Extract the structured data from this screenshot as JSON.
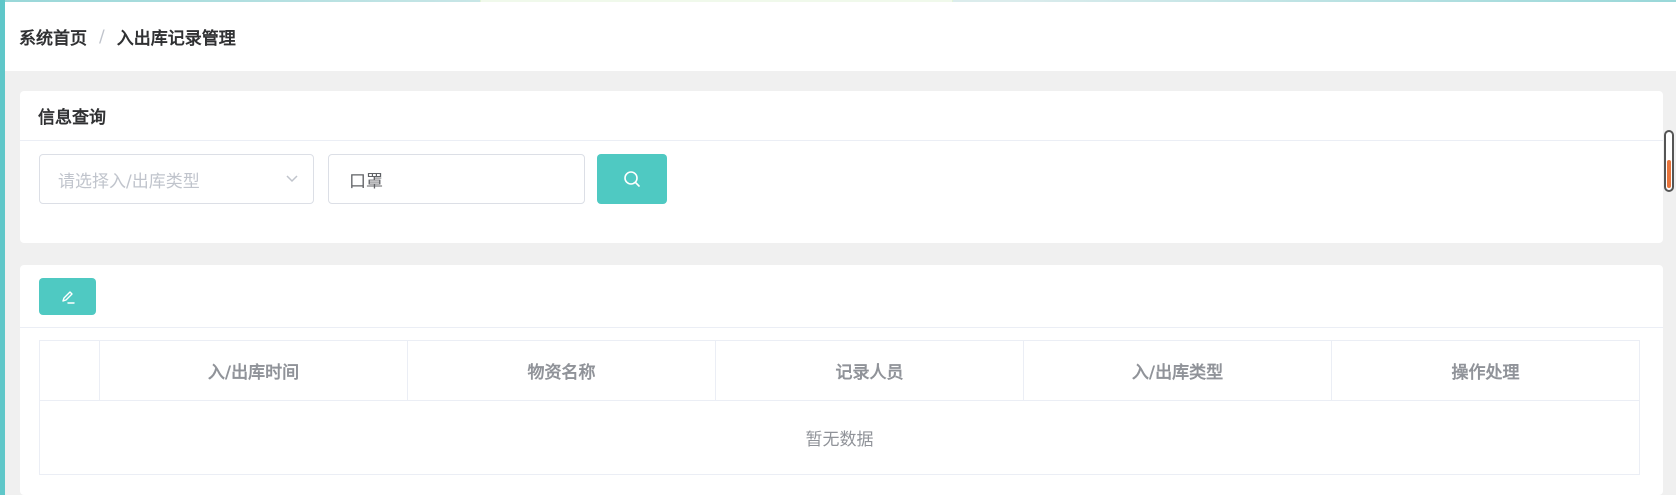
{
  "breadcrumb": {
    "home": "系统首页",
    "separator": "/",
    "current": "入出库记录管理"
  },
  "query": {
    "title": "信息查询",
    "type_select": {
      "placeholder": "请选择入/出库类型",
      "icon": "chevron-down-icon"
    },
    "keyword_input": {
      "value": "口罩"
    },
    "search_icon": "search-icon"
  },
  "toolbar": {
    "edit_icon": "edit-icon"
  },
  "table": {
    "columns": [
      "入/出库时间",
      "物资名称",
      "记录人员",
      "入/出库类型",
      "操作处理"
    ],
    "empty_text": "暂无数据"
  },
  "colors": {
    "accent": "#4fc9c2",
    "sidebar_strip": "#5fc7c9",
    "scroll_thumb": "#e8743b"
  }
}
